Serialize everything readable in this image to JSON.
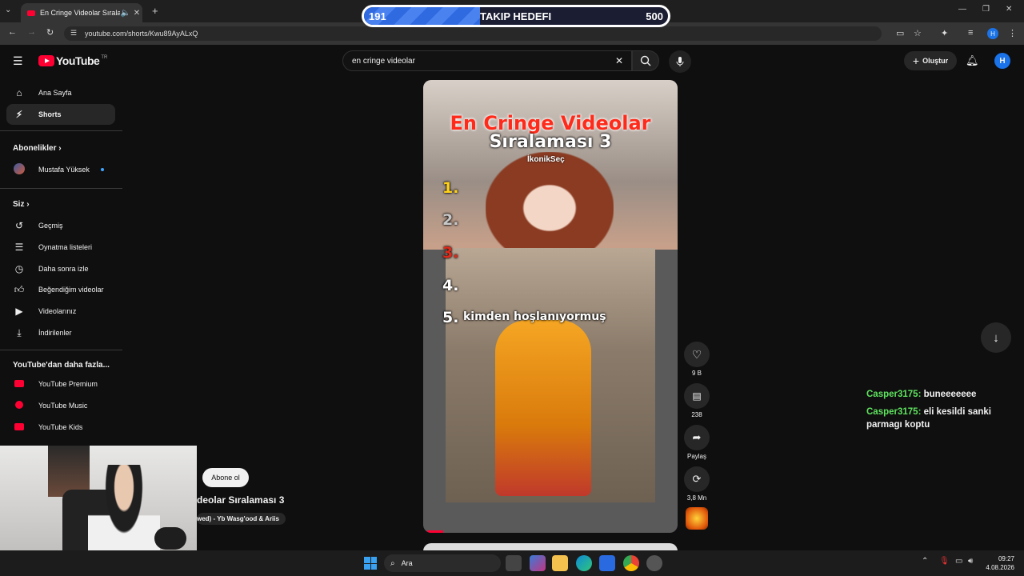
{
  "browser": {
    "tab_title": "En Cringe Videolar Sıralam...",
    "url": "youtube.com/shorts/Kwu89AyALxQ"
  },
  "overlay_goal": {
    "current": "191",
    "label": "TAKIP HEDEFI",
    "target": "500",
    "progress_fraction": 0.382
  },
  "youtube": {
    "logo_text": "YouTube",
    "region": "TR",
    "search_value": "en cringe videolar",
    "create_label": "Oluştur",
    "avatar_letter": "H"
  },
  "sidebar": {
    "items": [
      {
        "label": "Ana Sayfa",
        "icon": "home-icon"
      },
      {
        "label": "Shorts",
        "icon": "shorts-icon"
      }
    ],
    "subs_header": "Abonelikler",
    "subs": [
      {
        "label": "Mustafa Yüksek"
      }
    ],
    "you_header": "Siz",
    "you_items": [
      {
        "label": "Geçmiş",
        "icon": "history-icon"
      },
      {
        "label": "Oynatma listeleri",
        "icon": "playlist-icon"
      },
      {
        "label": "Daha sonra izle",
        "icon": "clock-icon"
      },
      {
        "label": "Beğendiğim videolar",
        "icon": "thumbs-up-icon"
      },
      {
        "label": "Videolarınız",
        "icon": "video-icon"
      },
      {
        "label": "İndirilenler",
        "icon": "download-icon"
      }
    ],
    "more_header": "YouTube'dan daha fazla...",
    "more_items": [
      {
        "label": "YouTube Premium"
      },
      {
        "label": "YouTube Music"
      },
      {
        "label": "YouTube Kids"
      }
    ]
  },
  "short": {
    "title_line1": "En Cringe Videolar",
    "title_line2": "Sıralaması 3",
    "tag": "İkonikSeç",
    "ranks": [
      "1.",
      "2.",
      "3.",
      "4.",
      "5."
    ],
    "rank5_text": "kimden hoşlanıyormuş",
    "video_title": "deolar Sıralaması 3",
    "music": "wed) - Yb Wasg'ood & Ariis",
    "subscribe_label": "Abone ol",
    "likes": "9 B",
    "comments": "238",
    "share_label": "Paylaş",
    "remix_count": "3,8 Mn"
  },
  "chat": [
    {
      "user": "Casper3175:",
      "message": "buneeeeeee"
    },
    {
      "user": "Casper3175:",
      "message": "eli kesildi sanki parmagı koptu"
    }
  ],
  "taskbar": {
    "search_placeholder": "Ara",
    "time": "09:27",
    "date": "4.08.2026"
  }
}
